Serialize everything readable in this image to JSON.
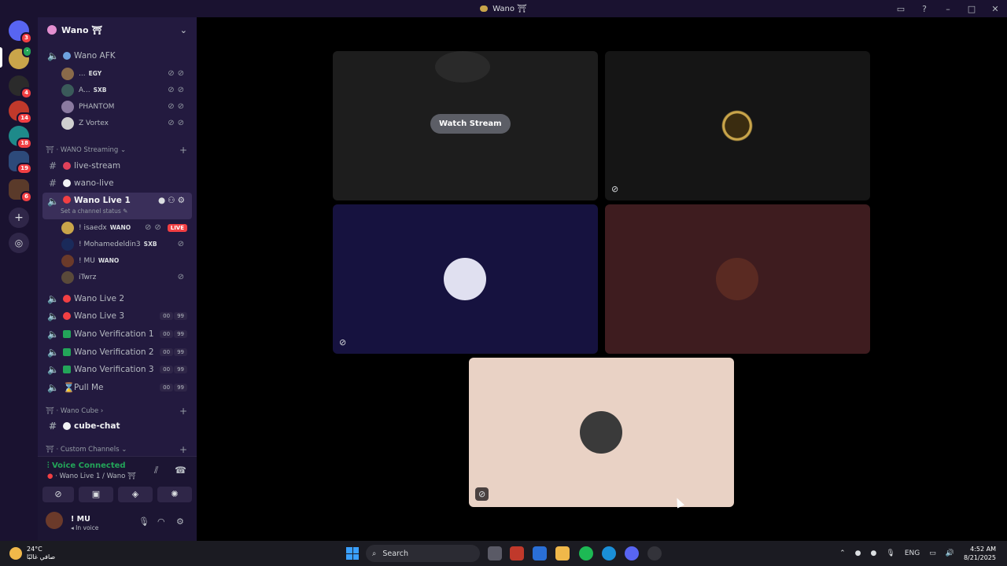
{
  "window": {
    "title": "Wano ⛩"
  },
  "rail": {
    "badges": [
      "3",
      "4",
      "14",
      "18",
      "19",
      "6"
    ]
  },
  "guild": {
    "name": "Wano ⛩"
  },
  "channels": {
    "afk": "Wano AFK",
    "afk_users": [
      {
        "name": "...",
        "tag": "EGY"
      },
      {
        "name": "A...",
        "tag": "SXB"
      },
      {
        "name": "PHANTOM",
        "tag": ""
      },
      {
        "name": "Z Vortex",
        "tag": ""
      }
    ],
    "cat_streaming": "WANO Streaming",
    "live_stream": "live-stream",
    "wano_live": "wano-live",
    "live1": "Wano Live 1",
    "live1_status": "Set a channel status",
    "live1_users": [
      {
        "name": "! isaedx",
        "tag": "WANO",
        "live": "LIVE"
      },
      {
        "name": "! Mohamedeldin3",
        "tag": "SXB"
      },
      {
        "name": "! MU",
        "tag": "WANO"
      },
      {
        "name": "iTwrz",
        "tag": ""
      }
    ],
    "live2": "Wano Live 2",
    "live3": "Wano Live 3",
    "ver1": "Wano Verification 1",
    "ver2": "Wano Verification 2",
    "ver3": "Wano Verification 3",
    "pull": "Pull Me",
    "count_a": "00",
    "count_b": "99",
    "cat_cube": "Wano Cube",
    "cube_chat": "cube-chat",
    "cat_custom": "Custom Channels"
  },
  "voice": {
    "status": "Voice Connected",
    "channel": "Wano Live 1 / Wano ⛩"
  },
  "me": {
    "name": "! MU",
    "status": "In voice"
  },
  "stage": {
    "watch_label": "Watch Stream"
  },
  "taskbar": {
    "temp": "24°C",
    "weather": "صافي غالبًا",
    "search": "Search",
    "lang": "ENG",
    "time": "4:52 AM",
    "date": "8/21/2025"
  },
  "colors": {
    "accent_green": "#23a559",
    "live_red": "#f23f43",
    "tile_navy": "#16123f",
    "tile_maroon": "#3e1c1f",
    "tile_peach": "#e9d2c5"
  }
}
